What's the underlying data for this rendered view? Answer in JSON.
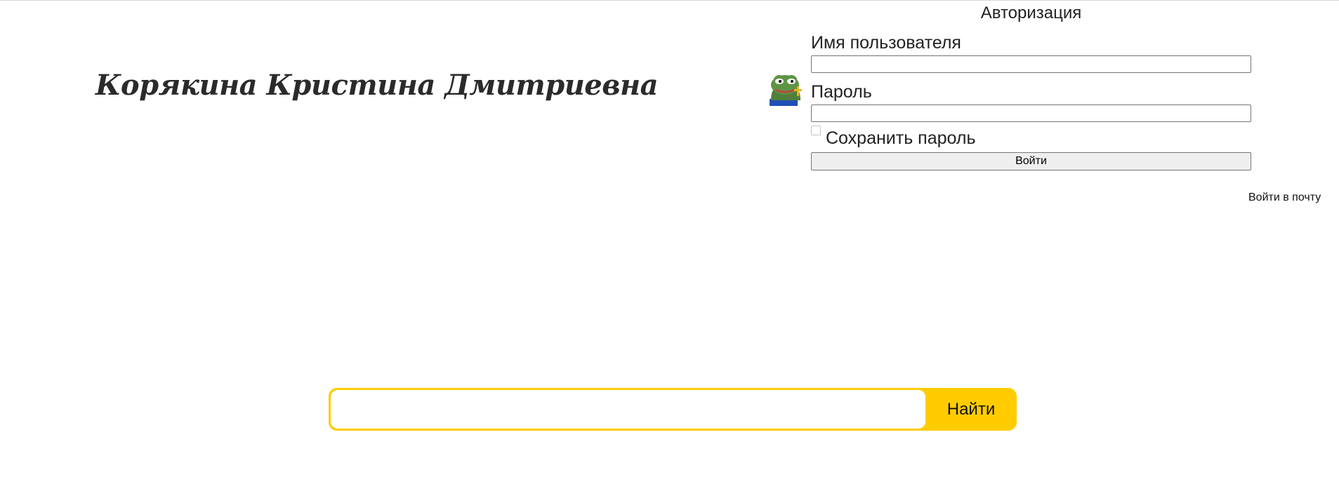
{
  "header": {
    "site_title": "Корякина Кристина Дмитриевна"
  },
  "auth": {
    "title": "Авторизация",
    "username_label": "Имя пользователя",
    "username_value": "",
    "password_label": "Пароль",
    "password_value": "",
    "remember_label": "Сохранить пароль",
    "remember_checked": false,
    "submit_label": "Войти",
    "avatar_icon": "frog-avatar-icon"
  },
  "links": {
    "mail_login": "Войти в почту"
  },
  "search": {
    "value": "",
    "button_label": "Найти",
    "accent_color": "#ffcc00"
  }
}
